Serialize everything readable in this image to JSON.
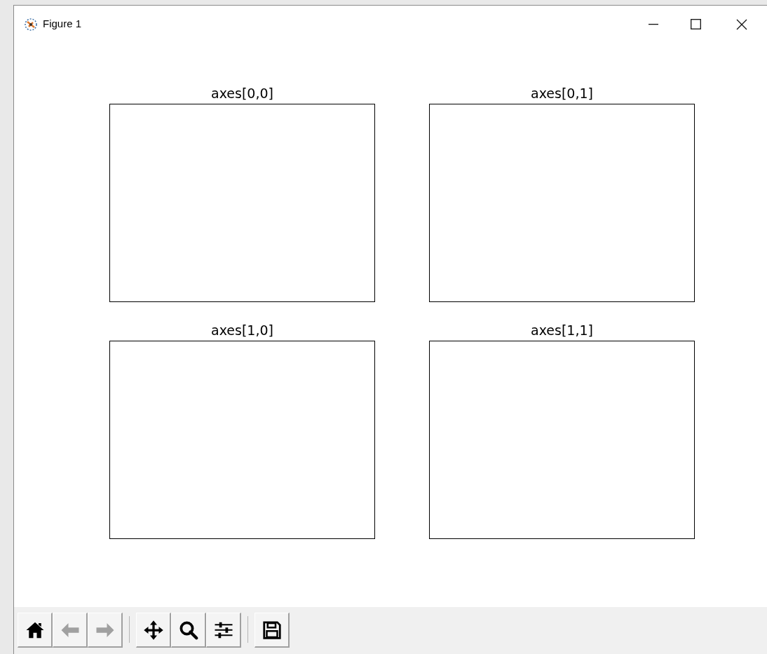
{
  "window": {
    "title": "Figure 1"
  },
  "axes": [
    {
      "title": "axes[0,0]"
    },
    {
      "title": "axes[0,1]"
    },
    {
      "title": "axes[1,0]"
    },
    {
      "title": "axes[1,1]"
    }
  ],
  "toolbar": {
    "groups": [
      [
        {
          "kind": "home",
          "disabled": false
        },
        {
          "kind": "back",
          "disabled": true
        },
        {
          "kind": "forward",
          "disabled": true
        }
      ],
      [
        {
          "kind": "pan",
          "disabled": false
        },
        {
          "kind": "zoom",
          "disabled": false
        },
        {
          "kind": "configure",
          "disabled": false
        }
      ],
      [
        {
          "kind": "save",
          "disabled": false
        }
      ]
    ]
  }
}
